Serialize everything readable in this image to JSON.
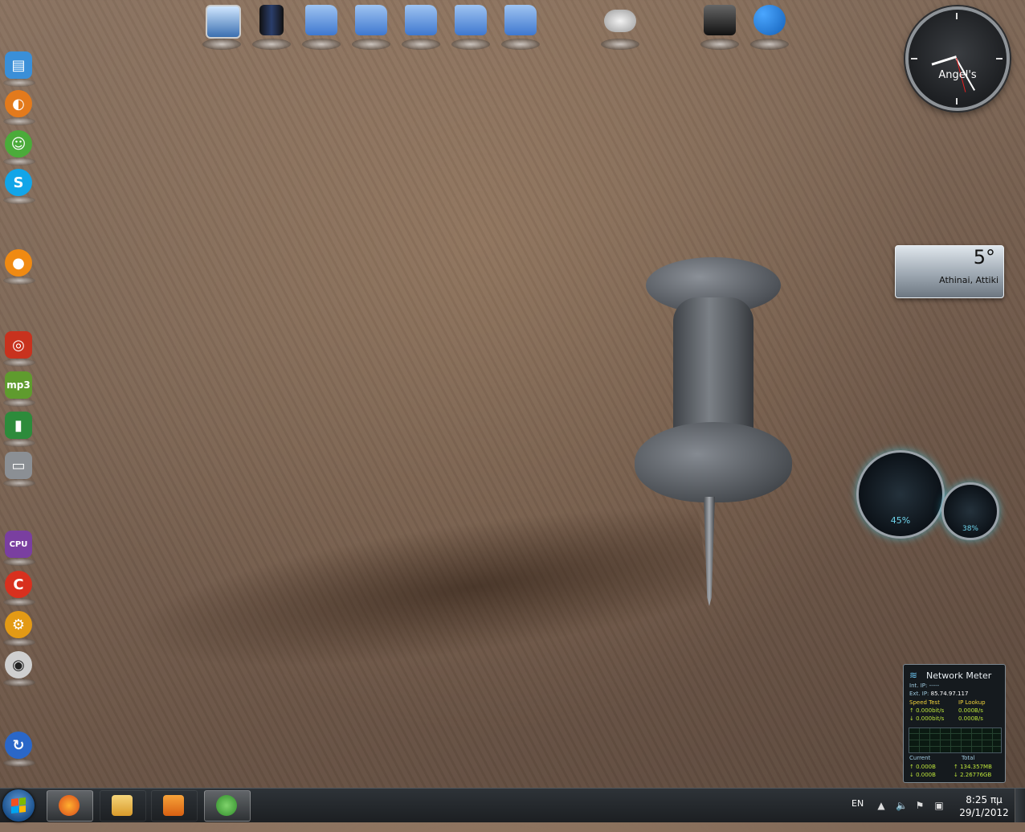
{
  "dock": {
    "items": [
      {
        "name": "remote-desktop-icon",
        "kind": "monitor"
      },
      {
        "name": "computer-tower-icon",
        "kind": "tower"
      },
      {
        "name": "documents-folder-icon",
        "kind": "folder"
      },
      {
        "name": "network-folder-icon",
        "kind": "folder"
      },
      {
        "name": "music-folder-icon",
        "kind": "folder"
      },
      {
        "name": "pictures-folder-icon",
        "kind": "folder"
      },
      {
        "name": "downloads-folder-icon",
        "kind": "folder"
      },
      {
        "name": "gamepad-icon",
        "kind": "gamepad"
      },
      {
        "name": "computer-icon",
        "kind": "dark"
      },
      {
        "name": "control-panel-icon",
        "kind": "settings"
      }
    ]
  },
  "left_icons": [
    {
      "name": "settings-app-icon",
      "color": "#3a8fd8",
      "glyph": "▤"
    },
    {
      "name": "firefox-like-app-icon",
      "color": "#e37a1c",
      "glyph": "◐"
    },
    {
      "name": "messenger-icon",
      "color": "#4bab3a",
      "glyph": "☺"
    },
    {
      "name": "skype-icon",
      "color": "#12a5e8",
      "glyph": "S"
    },
    {
      "name": "media-app-icon",
      "color": "#f08a12",
      "glyph": "●"
    },
    {
      "name": "burning-app-icon",
      "color": "#c8321e",
      "glyph": "◎"
    },
    {
      "name": "mp3-app-icon",
      "color": "#5f9b2e",
      "glyph": "mp3"
    },
    {
      "name": "phone-app-icon",
      "color": "#2d8b3b",
      "glyph": "▮"
    },
    {
      "name": "phone-laptop-app-icon",
      "color": "#8b8f94",
      "glyph": "▭"
    },
    {
      "name": "cpu-z-icon",
      "color": "#7a3fa0",
      "glyph": "CPU"
    },
    {
      "name": "ccleaner-icon",
      "color": "#d8301e",
      "glyph": "C"
    },
    {
      "name": "gear-tool-icon",
      "color": "#e39a15",
      "glyph": "⚙"
    },
    {
      "name": "mascot-app-icon",
      "color": "#cfcfcf",
      "glyph": "◉"
    },
    {
      "name": "refresh-app-icon",
      "color": "#2a67c8",
      "glyph": "↻"
    }
  ],
  "clock_gadget": {
    "label": "Angel's",
    "hour": 8,
    "minute": 25
  },
  "weather_gadget": {
    "temp": "5°",
    "location": "Athinai, Attiki"
  },
  "meter_gadget": {
    "cpu": "45%",
    "ram": "38%"
  },
  "network_meter": {
    "title": "Network Meter",
    "int_ip_label": "Int. IP:",
    "int_ip": "-----",
    "ext_ip_label": "Ext. IP:",
    "ext_ip": "85.74.97.117",
    "speed_test": "Speed Test",
    "ip_lookup": "IP Lookup",
    "up_speed": "0.000bit/s",
    "down_speed": "0.000bit/s",
    "up_bytes": "0.000B/s",
    "down_bytes": "0.000B/s",
    "current": "Current",
    "total": "Total",
    "cur_up": "0.000B",
    "cur_down": "0.000B",
    "tot_up": "134.357MB",
    "tot_down": "2.26776GB"
  },
  "taskbar": {
    "language": "EN",
    "time": "8:25 πμ",
    "date": "29/1/2012"
  }
}
